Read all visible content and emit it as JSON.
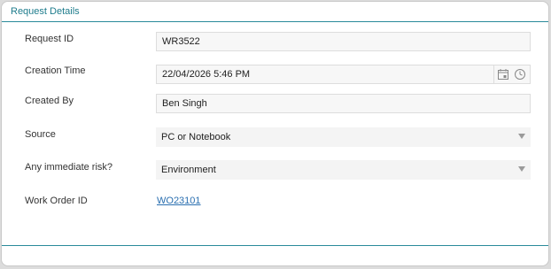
{
  "panel": {
    "title": "Request Details"
  },
  "fields": {
    "request_id": {
      "label": "Request ID",
      "value": "WR3522"
    },
    "creation_time": {
      "label": "Creation Time",
      "value": "22/04/2026 5:46 PM"
    },
    "created_by": {
      "label": "Created By",
      "value": "Ben Singh"
    },
    "source": {
      "label": "Source",
      "value": "PC or Notebook"
    },
    "immediate_risk": {
      "label": "Any immediate risk?",
      "value": "Environment"
    },
    "work_order_id": {
      "label": "Work Order ID",
      "value": "WO23101"
    }
  },
  "icons": {
    "calendar": "calendar-icon",
    "clock": "clock-icon",
    "dropdown": "chevron-down-icon"
  },
  "colors": {
    "accent": "#1e7c8c",
    "link": "#2a6fb0"
  }
}
